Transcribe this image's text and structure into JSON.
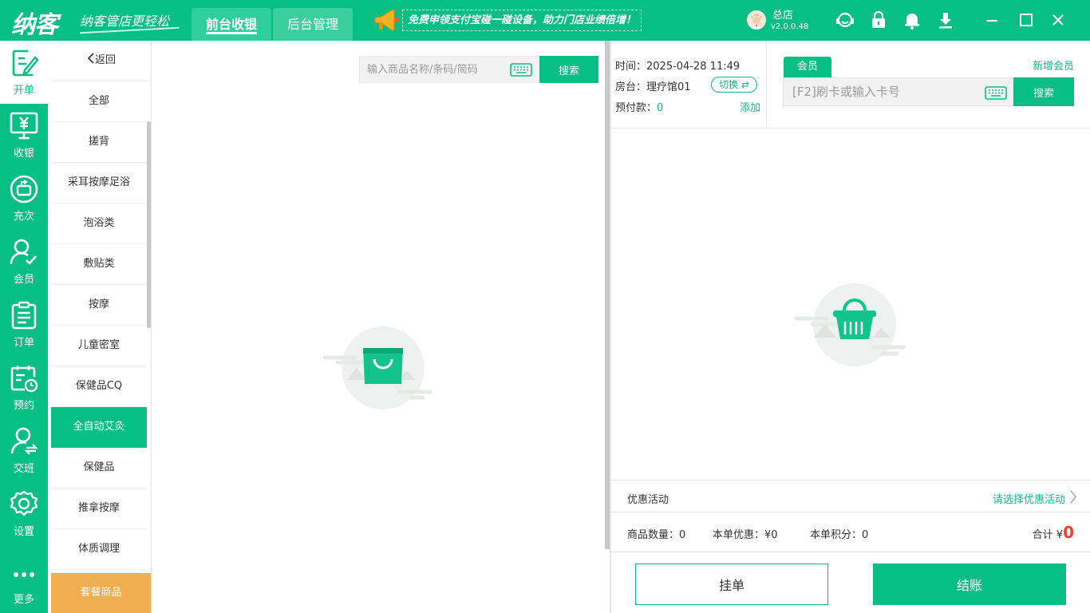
{
  "app": {
    "logo": "纳客",
    "slogan": "纳客管店更轻松",
    "tabs": [
      {
        "label": "前台收银",
        "active": true
      },
      {
        "label": "后台管理",
        "active": false
      }
    ],
    "promo": "免费申领支付宝碰一碰设备，助力门店业绩倍增！",
    "store_name": "总店",
    "version": "v2.0.0.48",
    "accent_color": "#08bf83",
    "icons": [
      "support-icon",
      "lock-icon",
      "bell-icon",
      "download-icon",
      "minimize-icon",
      "maximize-icon",
      "close-icon"
    ]
  },
  "nav": [
    {
      "label": "开单",
      "icon": "order-edit-icon",
      "active": true
    },
    {
      "label": "收银",
      "icon": "cashier-icon",
      "active": false
    },
    {
      "label": "充次",
      "icon": "recharge-icon",
      "active": false
    },
    {
      "label": "会员",
      "icon": "member-icon",
      "active": false
    },
    {
      "label": "订单",
      "icon": "clipboard-icon",
      "active": false
    },
    {
      "label": "预约",
      "icon": "calendar-clock-icon",
      "active": false
    },
    {
      "label": "交班",
      "icon": "handover-icon",
      "active": false
    },
    {
      "label": "设置",
      "icon": "gear-icon",
      "active": false
    },
    {
      "label": "更多",
      "icon": "more-icon",
      "active": false
    }
  ],
  "categories": {
    "back": "返回",
    "items": [
      "全部",
      "搓背",
      "采耳按摩足浴",
      "泡浴类",
      "敷贴类",
      "按摩",
      "儿童密室",
      "保健品CQ",
      "全自动艾灸",
      "保健品",
      "推拿按摩",
      "体质调理"
    ],
    "selected": "全自动艾灸",
    "package": "套餐商品"
  },
  "product_search": {
    "placeholder": "输入商品名称/条码/简码",
    "button": "搜索"
  },
  "order_info": {
    "time_label": "时间：",
    "time_value": "2025-04-28 11:49",
    "room_label": "房台：",
    "room_value": "理疗馆01",
    "switch_label": "切换 ⇄",
    "prepay_label": "预付款：",
    "prepay_value": "0",
    "add_label": "添加"
  },
  "member": {
    "tab": "会员",
    "new_member": "新增会员",
    "placeholder": "[F2]刷卡或输入卡号",
    "search_button": "搜索"
  },
  "promotion": {
    "label": "优惠活动",
    "link": "请选择优惠活动"
  },
  "summary": {
    "qty_label": "商品数量：",
    "qty_value": "0",
    "discount_label": "本单优惠：",
    "discount_value": "¥0",
    "points_label": "本单积分：",
    "points_value": "0",
    "total_label": "合计 ¥",
    "total_value": "0"
  },
  "actions": {
    "hold": "挂单",
    "checkout": "结账"
  }
}
